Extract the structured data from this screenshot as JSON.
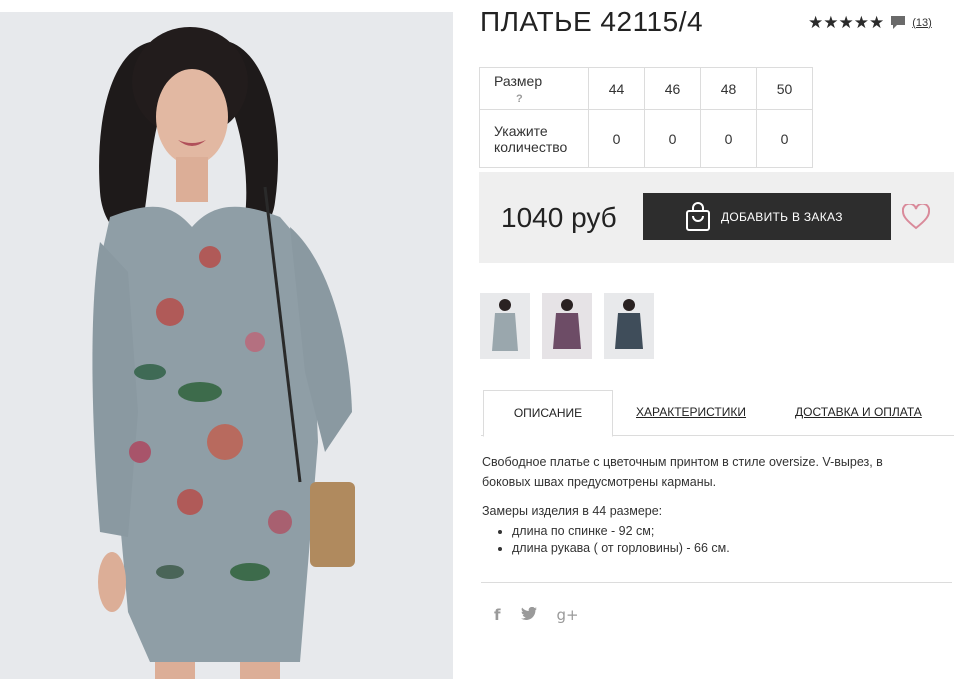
{
  "product": {
    "title": "ПЛАТЬЕ 42115/4",
    "stars": "★★★★★",
    "reviews_count": "(13)",
    "rating_value": 5
  },
  "sizes": {
    "row_label": "Размер",
    "help": "?",
    "values": [
      "44",
      "46",
      "48",
      "50"
    ],
    "qty_label": "Укажите количество",
    "quantities": [
      "0",
      "0",
      "0",
      "0"
    ]
  },
  "purchase": {
    "price": "1040 руб",
    "add_button": "ДОБАВИТЬ В ЗАКАЗ"
  },
  "tabs": [
    {
      "label": "ОПИСАНИЕ",
      "active": true
    },
    {
      "label": "ХАРАКТЕРИСТИКИ",
      "active": false
    },
    {
      "label": "ДОСТАВКА И ОПЛАТА",
      "active": false
    }
  ],
  "description": {
    "text": "Свободное платье с цветочным принтом в стиле oversize. V-вырез, в боковых швах предусмотрены карманы.",
    "measure_title": "Замеры изделия в 44 размере:",
    "measures": [
      "длина по спинке - 92 см;",
      "длина рукава ( от горловины) - 66 см."
    ]
  },
  "social": {
    "facebook": "f",
    "twitter": "twitter-bird-icon",
    "googleplus": "g+"
  },
  "colors": {
    "button": "#2d2d2d",
    "price_bg": "#efefef",
    "heart": "#d98a9a"
  }
}
